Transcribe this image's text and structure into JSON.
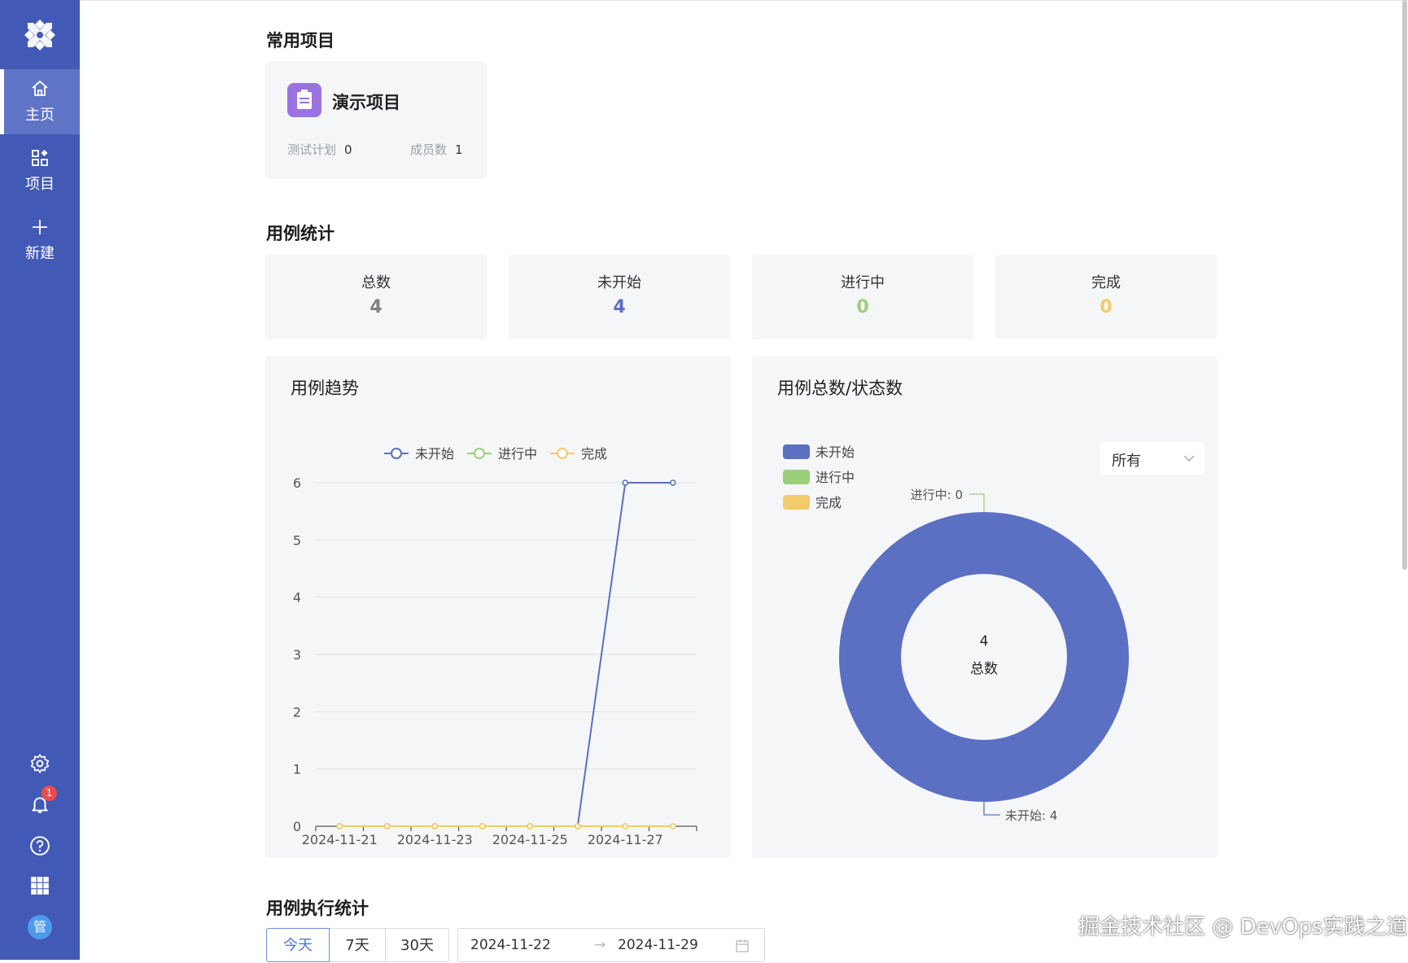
{
  "sidebar": {
    "nav": [
      {
        "label": "主页",
        "icon": "home-icon"
      },
      {
        "label": "项目",
        "icon": "apps-icon"
      },
      {
        "label": "新建",
        "icon": "plus-icon"
      }
    ],
    "notification_count": "1",
    "avatar_text": "管",
    "accent": "#4259b5"
  },
  "frequent_projects": {
    "title": "常用项目",
    "projects": [
      {
        "name": "演示项目",
        "test_plans_label": "测试计划",
        "test_plans": "0",
        "members_label": "成员数",
        "members": "1"
      }
    ]
  },
  "case_stats": {
    "title": "用例统计",
    "cards": [
      {
        "label": "总数",
        "value": "4",
        "color": "#7f7f7f"
      },
      {
        "label": "未开始",
        "value": "4",
        "color": "#5b6fc3"
      },
      {
        "label": "进行中",
        "value": "0",
        "color": "#9ccf7a"
      },
      {
        "label": "完成",
        "value": "0",
        "color": "#f2cb6b"
      }
    ]
  },
  "trend": {
    "title": "用例趋势",
    "chart_data": {
      "type": "line",
      "x": [
        "2024-11-21",
        "2024-11-22",
        "2024-11-23",
        "2024-11-24",
        "2024-11-25",
        "2024-11-26",
        "2024-11-27",
        "2024-11-28"
      ],
      "x_tick_labels": [
        "2024-11-21",
        "2024-11-23",
        "2024-11-25",
        "2024-11-27"
      ],
      "y_ticks": [
        "0",
        "1",
        "2",
        "3",
        "4",
        "5",
        "6"
      ],
      "ylim": [
        0,
        6
      ],
      "grid": true,
      "legend_position": "top",
      "series": [
        {
          "name": "未开始",
          "color": "#5b6fc3",
          "values": [
            0,
            0,
            0,
            0,
            0,
            0,
            6,
            6
          ]
        },
        {
          "name": "进行中",
          "color": "#9ccf7a",
          "values": [
            0,
            0,
            0,
            0,
            0,
            0,
            0,
            0
          ]
        },
        {
          "name": "完成",
          "color": "#f2cb6b",
          "values": [
            0,
            0,
            0,
            0,
            0,
            0,
            0,
            0
          ]
        }
      ]
    }
  },
  "status_pie": {
    "title": "用例总数/状态数",
    "filter_value": "所有",
    "chart_data": {
      "type": "pie",
      "legend_position": "top-left",
      "center_value": "4",
      "center_label": "总数",
      "slices": [
        {
          "name": "未开始",
          "value": 4,
          "color": "#5b6fc3",
          "callout": "未开始: 4"
        },
        {
          "name": "进行中",
          "value": 0,
          "color": "#9ccf7a",
          "callout": "进行中: 0"
        },
        {
          "name": "完成",
          "value": 0,
          "color": "#f2cb6b"
        }
      ]
    }
  },
  "execution_stats": {
    "title": "用例执行统计",
    "ranges": [
      "今天",
      "7天",
      "30天"
    ],
    "active_range": "今天",
    "start_date": "2024-11-22",
    "end_date": "2024-11-29",
    "arrow": "→"
  },
  "watermark": "掘金技术社区 @ DevOps实践之道"
}
